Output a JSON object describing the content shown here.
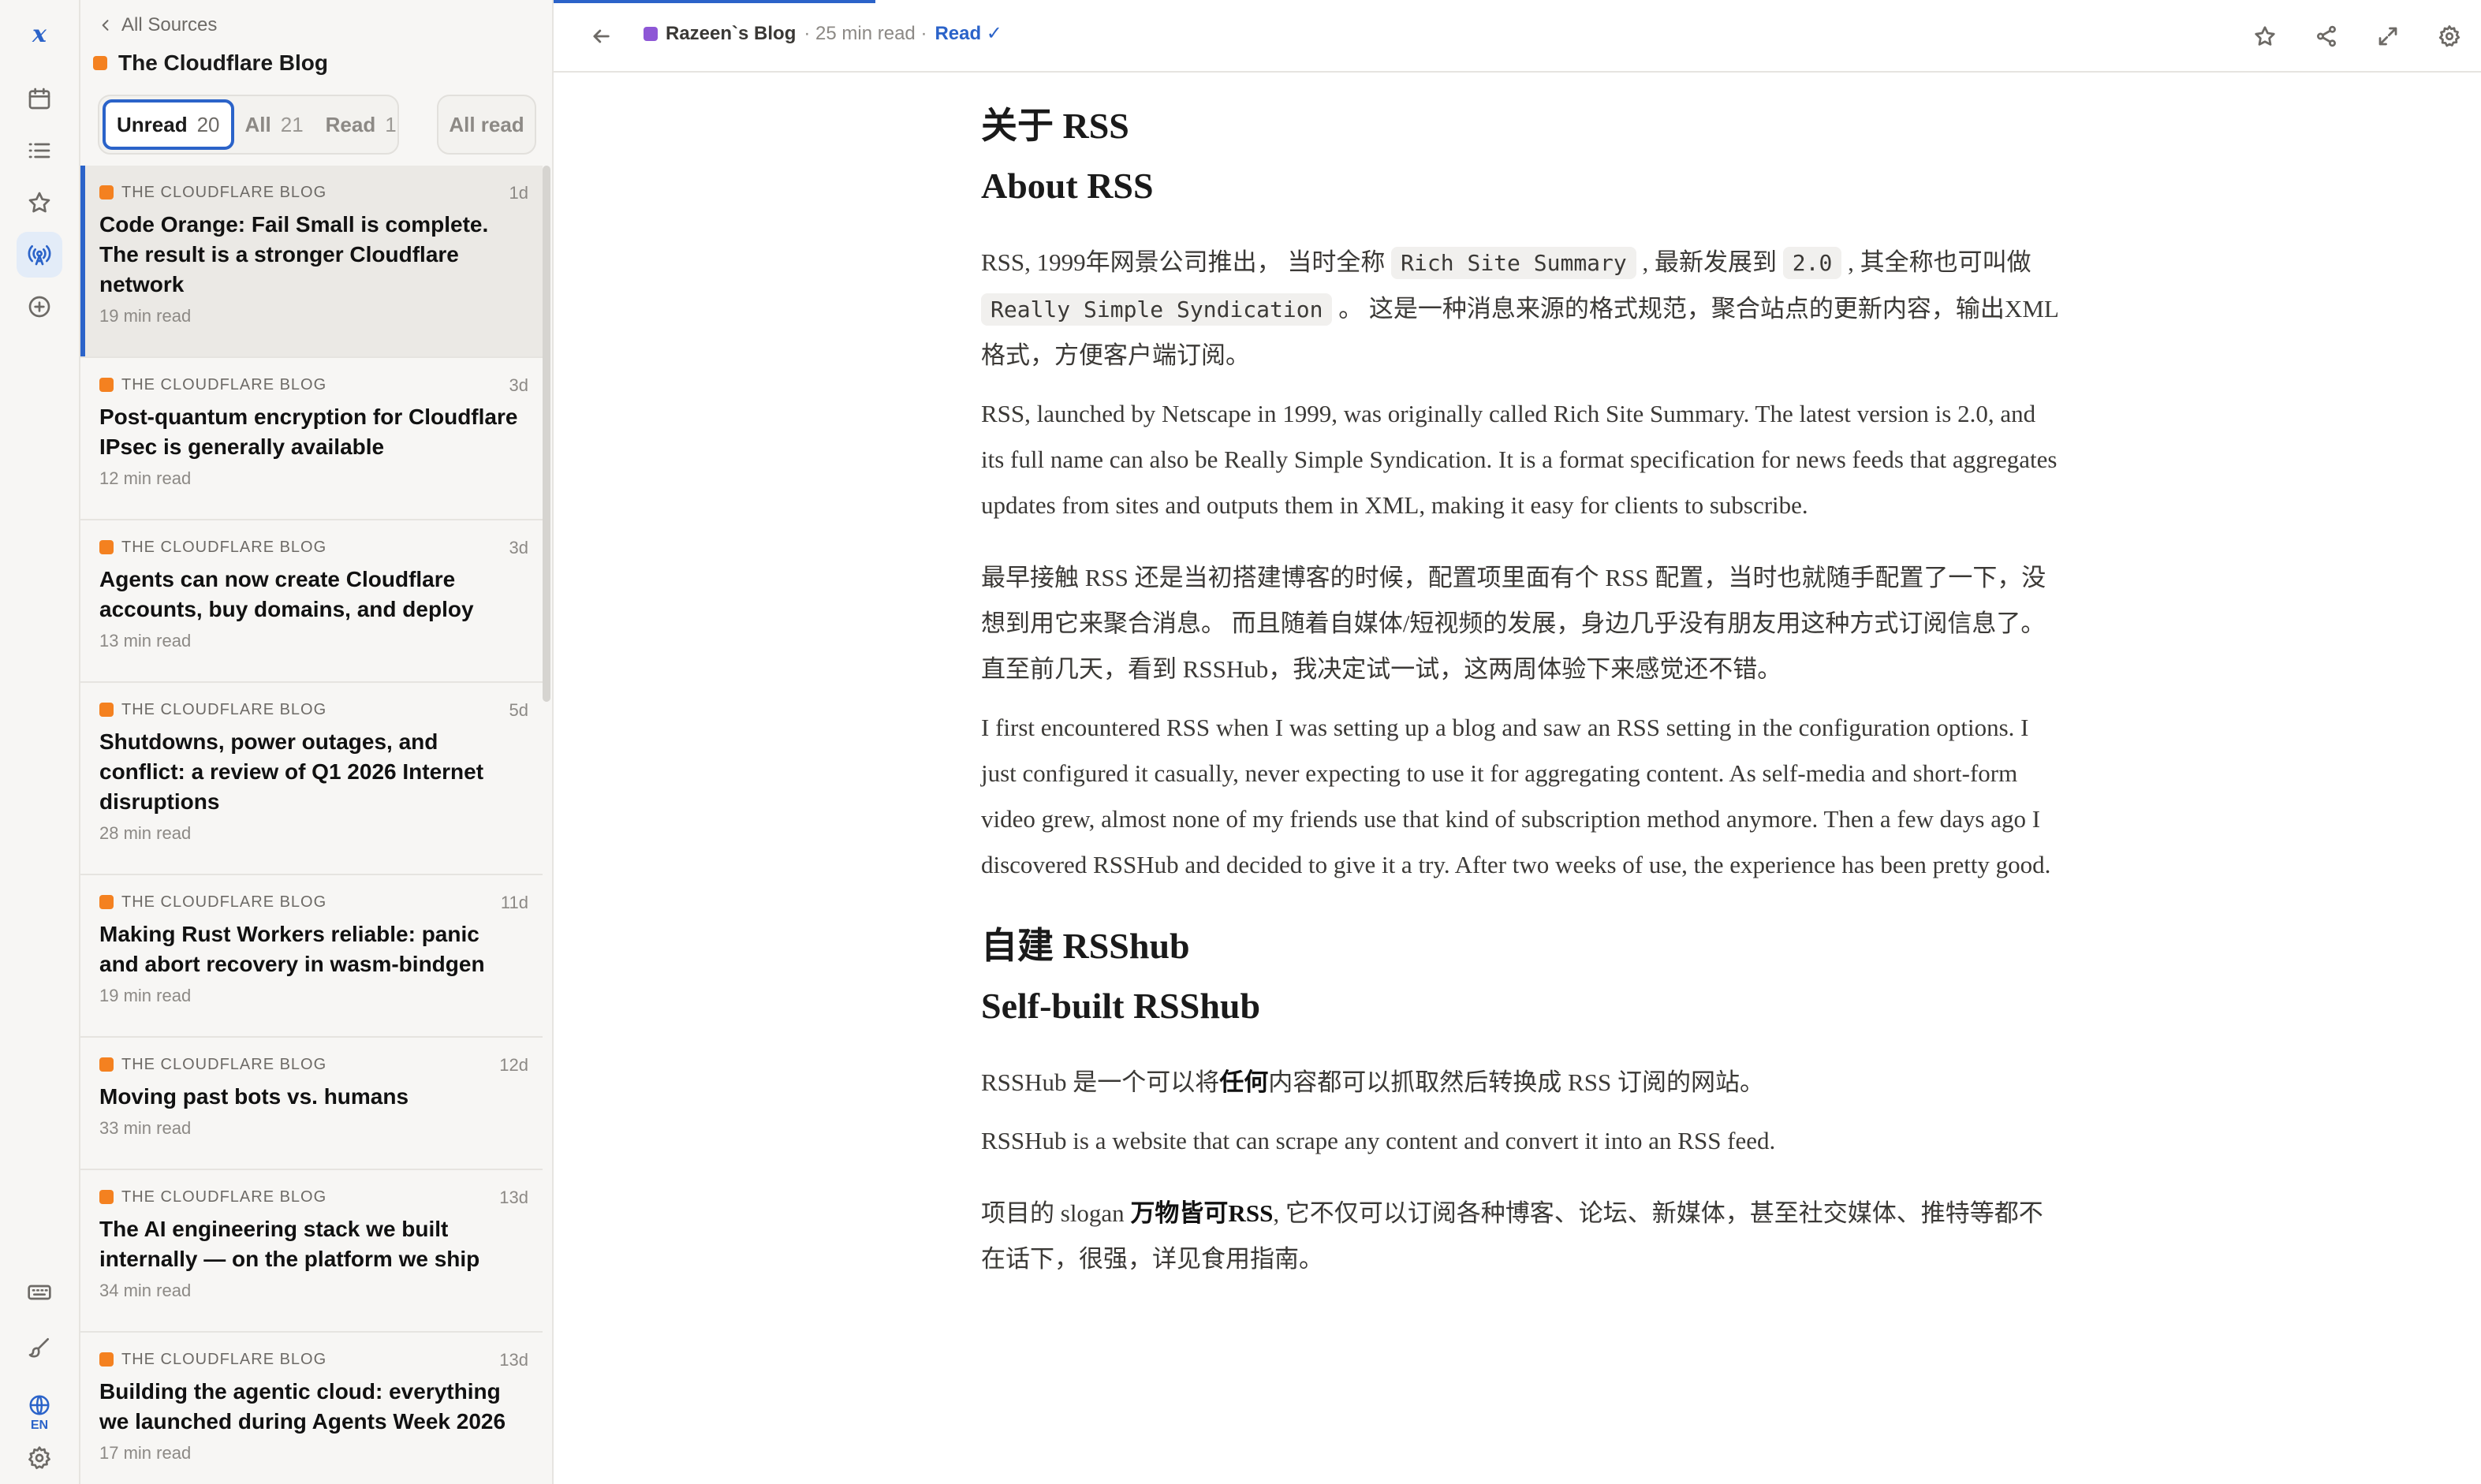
{
  "app": {
    "logo": "x",
    "lang": "EN"
  },
  "rail": {
    "icons": [
      "calendar-icon",
      "list-icon",
      "star-icon",
      "rss-antenna-icon",
      "plus-circle-icon",
      "keyboard-icon",
      "brush-icon",
      "globe-icon",
      "gear-icon"
    ]
  },
  "sidebar": {
    "back_label": "All Sources",
    "feed_title": "The Cloudflare Blog",
    "feed_color": "#f48120",
    "filters": [
      {
        "label": "Unread",
        "count": "20"
      },
      {
        "label": "All",
        "count": "21"
      },
      {
        "label": "Read",
        "count": "1"
      }
    ],
    "all_read_label": "All read",
    "items": [
      {
        "source": "THE CLOUDFLARE BLOG",
        "age": "1d",
        "title": "Code Orange: Fail Small is complete. The result is a stronger Cloudflare network",
        "read_time": "19 min read"
      },
      {
        "source": "THE CLOUDFLARE BLOG",
        "age": "3d",
        "title": "Post-quantum encryption for Cloudflare IPsec is generally available",
        "read_time": "12 min read"
      },
      {
        "source": "THE CLOUDFLARE BLOG",
        "age": "3d",
        "title": "Agents can now create Cloudflare accounts, buy domains, and deploy",
        "read_time": "13 min read"
      },
      {
        "source": "THE CLOUDFLARE BLOG",
        "age": "5d",
        "title": "Shutdowns, power outages, and conflict: a review of Q1 2026 Internet disruptions",
        "read_time": "28 min read"
      },
      {
        "source": "THE CLOUDFLARE BLOG",
        "age": "11d",
        "title": "Making Rust Workers reliable: panic and abort recovery in wasm-bindgen",
        "read_time": "19 min read"
      },
      {
        "source": "THE CLOUDFLARE BLOG",
        "age": "12d",
        "title": "Moving past bots vs. humans",
        "read_time": "33 min read"
      },
      {
        "source": "THE CLOUDFLARE BLOG",
        "age": "13d",
        "title": "The AI engineering stack we built internally — on the platform we ship",
        "read_time": "34 min read"
      },
      {
        "source": "THE CLOUDFLARE BLOG",
        "age": "13d",
        "title": "Building the agentic cloud: everything we launched during Agents Week 2026",
        "read_time": "17 min read"
      }
    ]
  },
  "reader": {
    "blog_name": "Razeen`s Blog",
    "blog_color": "#8e57d6",
    "read_time": "· 25 min read ·",
    "read_status": "Read ✓",
    "toolbar_icons": [
      "star-icon",
      "share-icon",
      "expand-icon",
      "gear-icon"
    ],
    "h1_zh": "关于 RSS",
    "h1_en": "About RSS",
    "p1_zh_a": "RSS, 1999年网景公司推出， 当时全称 ",
    "p1_code1": "Rich Site Summary",
    "p1_zh_b": " , 最新发展到 ",
    "p1_code2": "2.0",
    "p1_zh_c": " , 其全称也可叫做 ",
    "p1_code3": "Really Simple Syndication",
    "p1_zh_d": " 。 这是一种消息来源的格式规范，聚合站点的更新内容，输出XML格式，方便客户端订阅。",
    "p1_en": "RSS, launched by Netscape in 1999, was originally called Rich Site Summary. The latest version is 2.0, and its full name can also be Really Simple Syndication. It is a format specification for news feeds that aggregates updates from sites and outputs them in XML, making it easy for clients to subscribe.",
    "p2_zh": "最早接触 RSS 还是当初搭建博客的时候，配置项里面有个 RSS 配置，当时也就随手配置了一下，没想到用它来聚合消息。 而且随着自媒体/短视频的发展，身边几乎没有朋友用这种方式订阅信息了。直至前几天，看到 RSSHub，我决定试一试，这两周体验下来感觉还不错。",
    "p2_en": "I first encountered RSS when I was setting up a blog and saw an RSS setting in the configuration options. I just configured it casually, never expecting to use it for aggregating content. As self-media and short-form video grew, almost none of my friends use that kind of subscription method anymore. Then a few days ago I discovered RSSHub and decided to give it a try. After two weeks of use, the experience has been pretty good.",
    "h2_zh": "自建 RSShub",
    "h2_en": "Self-built RSShub",
    "p3_zh_a": "RSSHub 是一个可以将",
    "p3_zh_bold": "任何",
    "p3_zh_b": "内容都可以抓取然后转换成 RSS 订阅的网站。",
    "p3_en": "RSSHub is a website that can scrape any content and convert it into an RSS feed.",
    "p4_zh_a": "项目的 slogan ",
    "p4_zh_bold": "万物皆可RSS",
    "p4_zh_b": ", 它不仅可以订阅各种博客、论坛、新媒体，甚至社交媒体、推特等都不在话下，很强，详见食用指南。"
  }
}
